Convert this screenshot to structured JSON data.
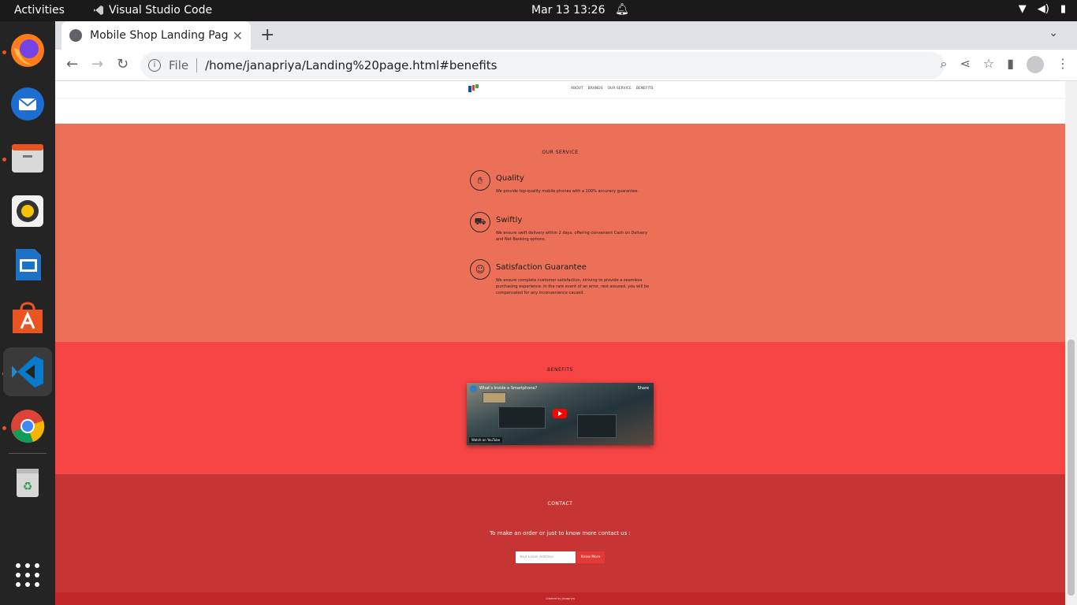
{
  "system": {
    "activities": "Activities",
    "app_name": "Visual Studio Code",
    "clock": "Mar 13  13:26"
  },
  "browser": {
    "tab_title": "Mobile Shop Landing Pag",
    "url_scheme": "File",
    "url": "/home/janapriya/Landing%20page.html#benefits"
  },
  "site": {
    "nav_links": [
      "ABOUT",
      "BRANDS",
      "OUR SERVICE",
      "BENEFITS"
    ],
    "service": {
      "title": "OUR SERVICE",
      "features": [
        {
          "icon": "hand-phone-icon",
          "heading": "Quality",
          "text": "We provide top-quality mobile phones with a 100% accuracy guarantee."
        },
        {
          "icon": "delivery-truck-icon",
          "heading": "Swiftly",
          "text": "We ensure swift delivery within 2 days, offering convenient Cash on Delivery and Net Banking options."
        },
        {
          "icon": "smiley-face-icon",
          "heading": "Satisfaction Guarantee",
          "text": "We ensure complete customer satisfaction, striving to provide a seamless purchasing experience. In the rare event of an error, rest assured, you will be compensated for any inconvenience caused."
        }
      ]
    },
    "benefits": {
      "title": "BENEFITS",
      "video_title": "What's Inside a Smartphone?",
      "share_label": "Share",
      "watch_label": "Watch on YouTube"
    },
    "contact": {
      "title": "CONTACT",
      "text": "To make an order or just to know more contact us :",
      "email_placeholder": "Your Email Address",
      "button_label": "Know More"
    },
    "footer": "Created by Janapriya"
  },
  "colors": {
    "service_bg": "#ec7057",
    "benefits_bg": "#f74545",
    "contact_bg": "#c63434",
    "button_bg": "#e53935"
  }
}
